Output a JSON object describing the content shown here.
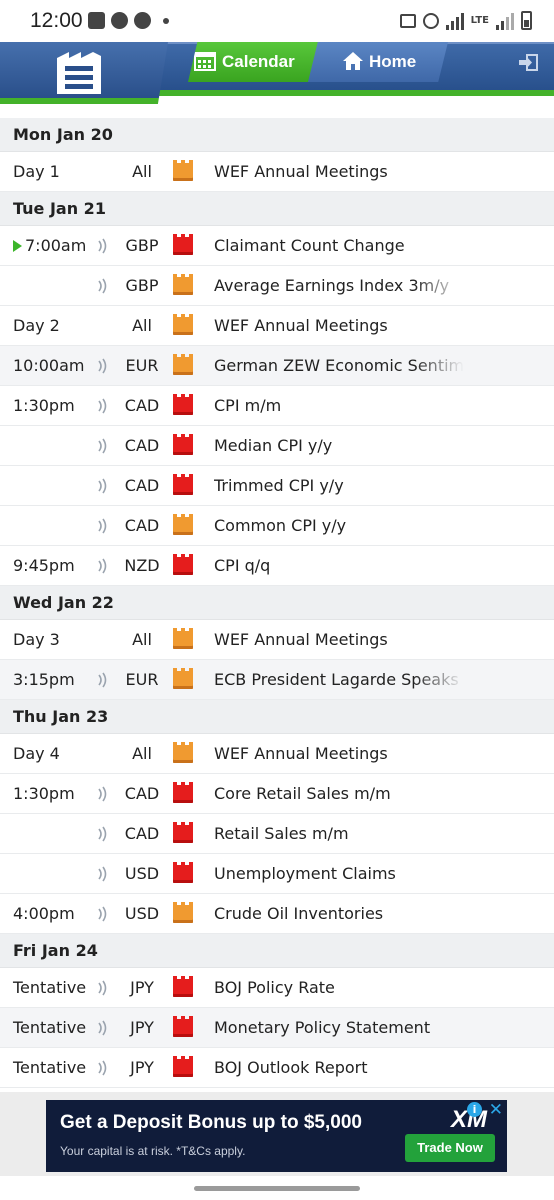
{
  "status_bar": {
    "time": "12:00",
    "network": "LTE"
  },
  "nav": {
    "tabs": [
      {
        "label": "Calendar",
        "active": true
      },
      {
        "label": "Home",
        "active": false
      }
    ]
  },
  "colors": {
    "high_impact": "#e51d1d",
    "medium_impact": "#f09a30",
    "accent_green": "#44b22a",
    "header_blue": "#28508c"
  },
  "days": [
    {
      "heading": "Mon Jan 20",
      "events": [
        {
          "time": "Day 1",
          "sound": false,
          "currency": "All",
          "impact": "medium",
          "title": "WEF Annual Meetings"
        }
      ]
    },
    {
      "heading": "Tue Jan 21",
      "events": [
        {
          "time": "7:00am",
          "live": true,
          "sound": true,
          "currency": "GBP",
          "impact": "high",
          "title": "Claimant Count Change"
        },
        {
          "time": "",
          "sound": true,
          "currency": "GBP",
          "impact": "medium",
          "title": "Average Earnings Index 3m/y"
        },
        {
          "time": "Day 2",
          "sound": false,
          "currency": "All",
          "impact": "medium",
          "title": "WEF Annual Meetings"
        },
        {
          "time": "10:00am",
          "sound": true,
          "currency": "EUR",
          "impact": "medium",
          "title": "German ZEW Economic Sentiment"
        },
        {
          "time": "1:30pm",
          "sound": true,
          "currency": "CAD",
          "impact": "high",
          "title": "CPI m/m"
        },
        {
          "time": "",
          "sound": true,
          "currency": "CAD",
          "impact": "high",
          "title": "Median CPI y/y"
        },
        {
          "time": "",
          "sound": true,
          "currency": "CAD",
          "impact": "high",
          "title": "Trimmed CPI y/y"
        },
        {
          "time": "",
          "sound": true,
          "currency": "CAD",
          "impact": "medium",
          "title": "Common CPI y/y"
        },
        {
          "time": "9:45pm",
          "sound": true,
          "currency": "NZD",
          "impact": "high",
          "title": "CPI q/q"
        }
      ]
    },
    {
      "heading": "Wed Jan 22",
      "events": [
        {
          "time": "Day 3",
          "sound": false,
          "currency": "All",
          "impact": "medium",
          "title": "WEF Annual Meetings"
        },
        {
          "time": "3:15pm",
          "sound": true,
          "currency": "EUR",
          "impact": "medium",
          "title": "ECB President Lagarde Speaks"
        }
      ]
    },
    {
      "heading": "Thu Jan 23",
      "events": [
        {
          "time": "Day 4",
          "sound": false,
          "currency": "All",
          "impact": "medium",
          "title": "WEF Annual Meetings"
        },
        {
          "time": "1:30pm",
          "sound": true,
          "currency": "CAD",
          "impact": "high",
          "title": "Core Retail Sales m/m"
        },
        {
          "time": "",
          "sound": true,
          "currency": "CAD",
          "impact": "high",
          "title": "Retail Sales m/m"
        },
        {
          "time": "",
          "sound": true,
          "currency": "USD",
          "impact": "high",
          "title": "Unemployment Claims"
        },
        {
          "time": "4:00pm",
          "sound": true,
          "currency": "USD",
          "impact": "medium",
          "title": "Crude Oil Inventories"
        }
      ]
    },
    {
      "heading": "Fri Jan 24",
      "events": [
        {
          "time": "Tentative",
          "sound": true,
          "currency": "JPY",
          "impact": "high",
          "title": "BOJ Policy Rate"
        },
        {
          "time": "Tentative",
          "sound": true,
          "currency": "JPY",
          "impact": "high",
          "title": "Monetary Policy Statement"
        },
        {
          "time": "Tentative",
          "sound": true,
          "currency": "JPY",
          "impact": "high",
          "title": "BOJ Outlook Report"
        }
      ]
    }
  ],
  "ad": {
    "headline": "Get a Deposit Bonus up to $5,000",
    "subtext": "Your capital is at risk. *T&Cs apply.",
    "button": "Trade Now",
    "brand": "XM"
  }
}
